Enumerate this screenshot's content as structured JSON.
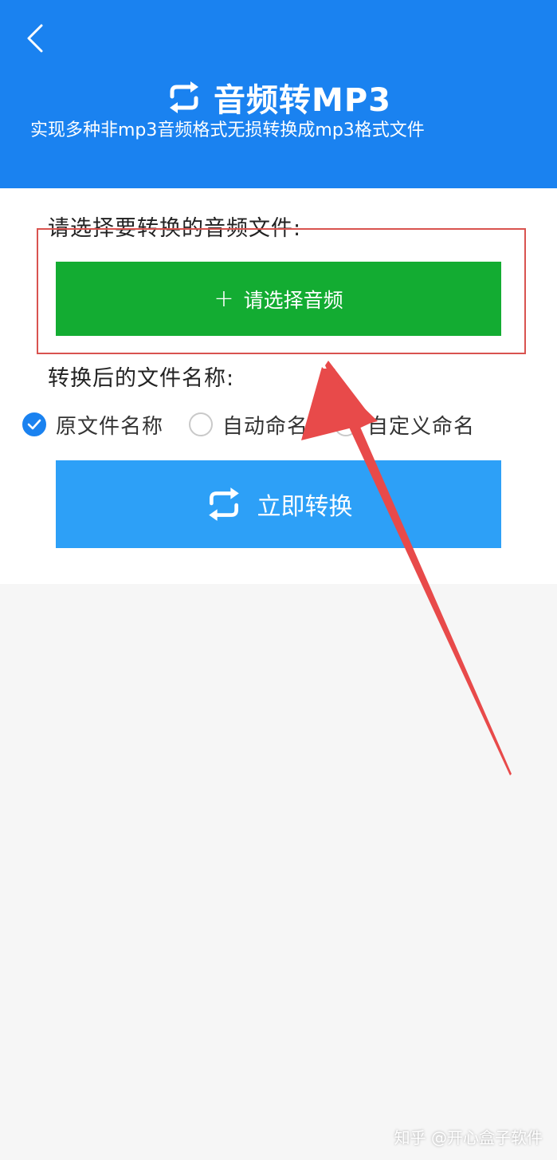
{
  "header": {
    "title": "音频转MP3",
    "subtitle": "实现多种非mp3音频格式无损转换成mp3格式文件"
  },
  "form": {
    "select_label": "请选择要转换的音频文件:",
    "select_button": "请选择音频",
    "name_label": "转换后的文件名称:",
    "options": [
      {
        "label": "原文件名称",
        "checked": true
      },
      {
        "label": "自动命名",
        "checked": false
      },
      {
        "label": "自定义命名",
        "checked": false
      }
    ],
    "convert_button": "立即转换"
  },
  "watermark": "知乎 @开心盒子软件",
  "colors": {
    "header_blue": "#1a82f0",
    "select_green": "#13ac32",
    "convert_blue": "#2da0f7",
    "highlight_red": "#d9534f",
    "arrow_red": "#e84a4a"
  },
  "icons": {
    "back": "back-chevron-icon",
    "refresh": "refresh-icon",
    "plus": "plus-icon",
    "check": "check-icon"
  }
}
